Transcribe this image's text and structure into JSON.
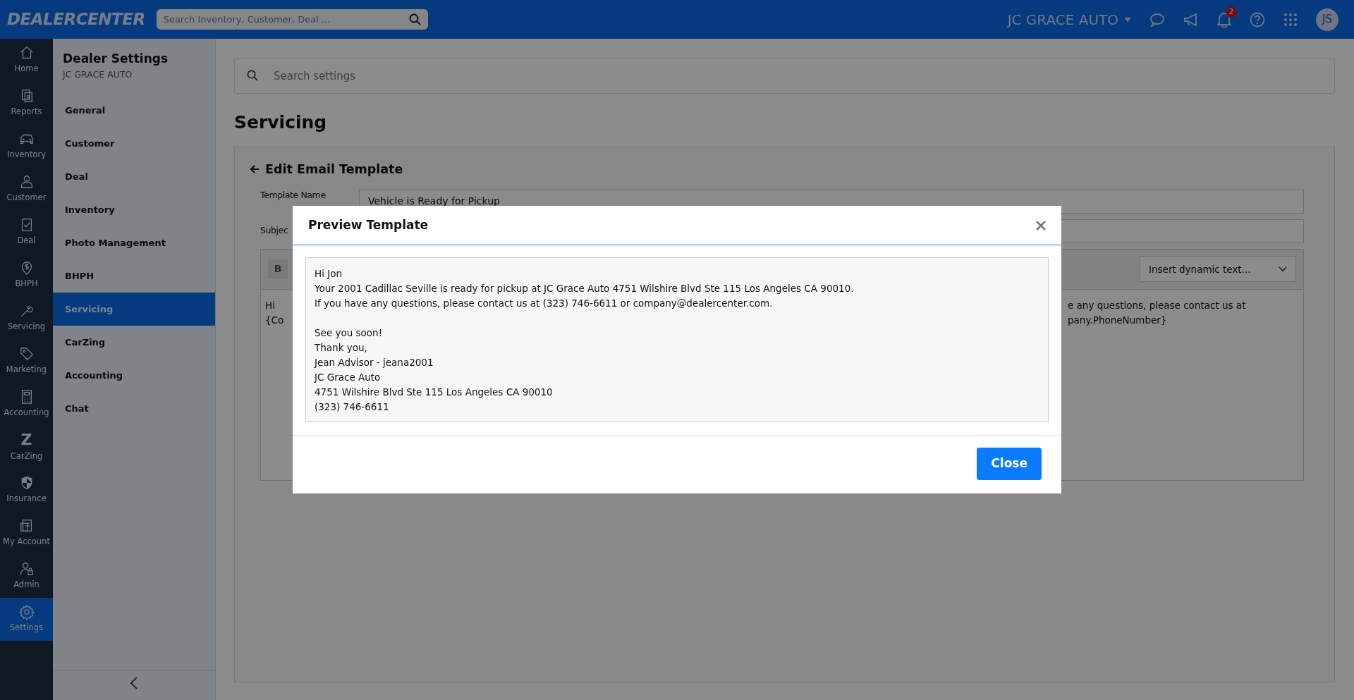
{
  "topbar": {
    "logo": "DEALERCENTER",
    "search_placeholder": "Search Inventory, Customer, Deal ...",
    "dealer": "JC GRACE AUTO",
    "notifications_count": "2",
    "avatar_initials": "JS"
  },
  "rail": [
    {
      "label": "Home",
      "selected": false
    },
    {
      "label": "Reports",
      "selected": false
    },
    {
      "label": "Inventory",
      "selected": false
    },
    {
      "label": "Customer",
      "selected": false
    },
    {
      "label": "Deal",
      "selected": false
    },
    {
      "label": "BHPH",
      "selected": false
    },
    {
      "label": "Servicing",
      "selected": false
    },
    {
      "label": "Marketing",
      "selected": false
    },
    {
      "label": "Accounting",
      "selected": false
    },
    {
      "label": "CarZing",
      "glyph": "Z",
      "selected": false
    },
    {
      "label": "Insurance",
      "selected": false
    },
    {
      "label": "My Account",
      "selected": false
    },
    {
      "label": "Admin",
      "selected": false
    },
    {
      "label": "Settings",
      "selected": true
    }
  ],
  "settings_panel": {
    "title": "Dealer Settings",
    "subtitle": "JC GRACE AUTO",
    "items": [
      {
        "label": "General",
        "selected": false
      },
      {
        "label": "Customer",
        "selected": false
      },
      {
        "label": "Deal",
        "selected": false
      },
      {
        "label": "Inventory",
        "selected": false
      },
      {
        "label": "Photo Management",
        "selected": false
      },
      {
        "label": "BHPH",
        "selected": false
      },
      {
        "label": "Servicing",
        "selected": true
      },
      {
        "label": "CarZing",
        "selected": false
      },
      {
        "label": "Accounting",
        "selected": false
      },
      {
        "label": "Chat",
        "selected": false
      }
    ]
  },
  "main": {
    "search_placeholder": "Search settings",
    "heading": "Servicing",
    "card": {
      "title": "Edit Email Template",
      "template_name_label": "Template Name",
      "template_name_value": "Vehicle is Ready for Pickup",
      "subject_label": "Subjec",
      "bold_button": "B",
      "dynamic_select": "Insert dynamic text...",
      "body_left": [
        "Hi",
        "{Co"
      ],
      "body_right": [
        "e any questions, please contact us at",
        "pany.PhoneNumber}"
      ]
    }
  },
  "modal": {
    "title": "Preview Template",
    "paragraphs": [
      [
        "Hi Jon",
        "Your 2001 Cadillac Seville is ready for pickup at JC Grace Auto 4751 Wilshire Blvd Ste 115 Los Angeles CA 90010.",
        "If you have any questions, please contact us at (323) 746-6611 or company@dealercenter.com."
      ],
      [
        "See you soon!",
        "Thank you,",
        "Jean Advisor - jeana2001",
        "JC Grace Auto",
        "4751 Wilshire Blvd Ste 115 Los Angeles CA 90010",
        "(323) 746-6611"
      ]
    ],
    "close_button": "Close"
  }
}
